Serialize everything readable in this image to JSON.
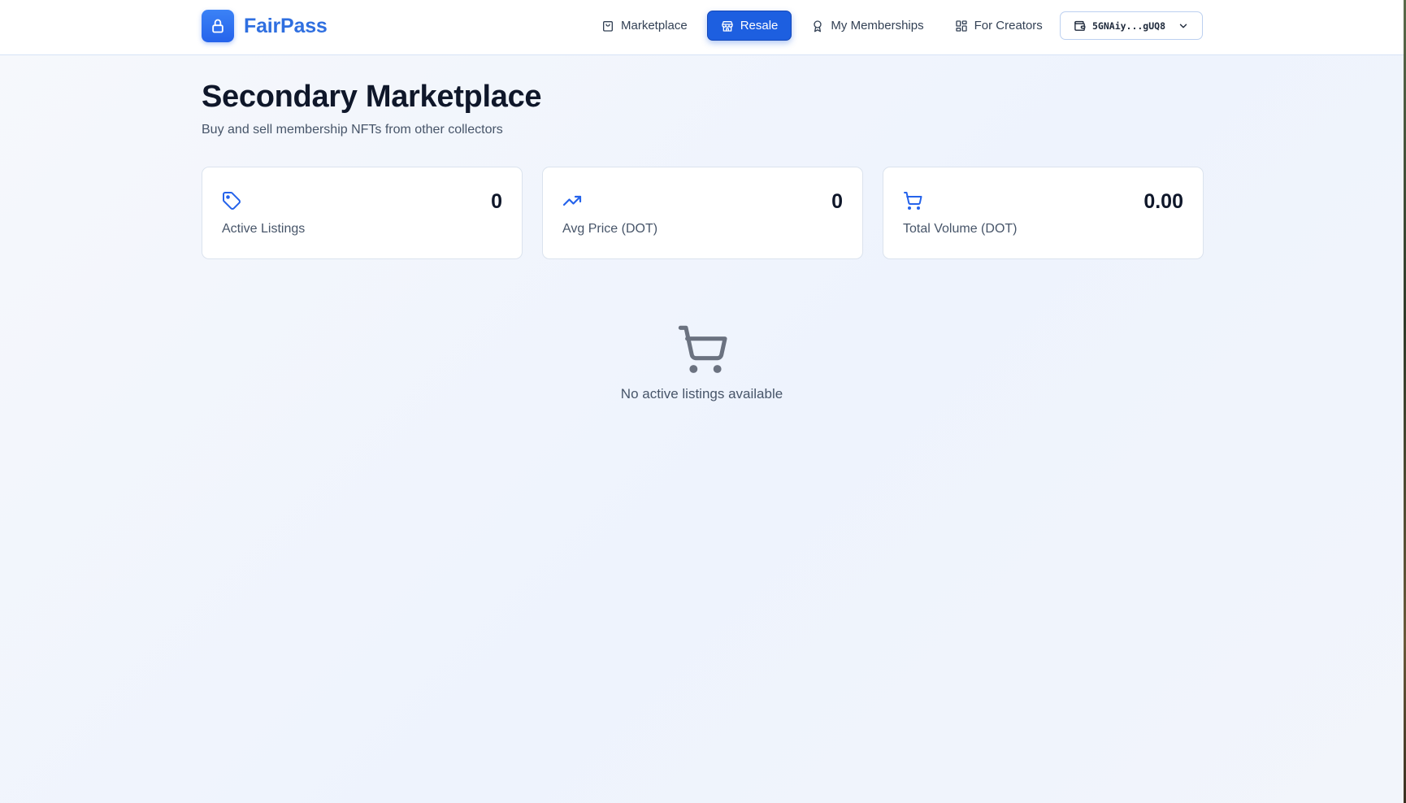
{
  "header": {
    "brand": "FairPass",
    "nav": [
      {
        "label": "Marketplace",
        "icon": "shopping-bag-icon",
        "active": false
      },
      {
        "label": "Resale",
        "icon": "store-icon",
        "active": true
      },
      {
        "label": "My Memberships",
        "icon": "award-icon",
        "active": false
      },
      {
        "label": "For Creators",
        "icon": "dashboard-icon",
        "active": false
      }
    ],
    "wallet": {
      "address": "5GNAiy...gUQ8",
      "icon": "wallet-icon"
    }
  },
  "page": {
    "title": "Secondary Marketplace",
    "subtitle": "Buy and sell membership NFTs from other collectors"
  },
  "stats": [
    {
      "label": "Active Listings",
      "value": "0",
      "icon": "tag-icon"
    },
    {
      "label": "Avg Price (DOT)",
      "value": "0",
      "icon": "trending-up-icon"
    },
    {
      "label": "Total Volume (DOT)",
      "value": "0.00",
      "icon": "cart-icon"
    }
  ],
  "empty_state": {
    "text": "No active listings available",
    "icon": "cart-icon"
  },
  "colors": {
    "accent": "#2563eb",
    "brand_text": "#2f6fe0",
    "icon_gray": "#6b7280"
  }
}
